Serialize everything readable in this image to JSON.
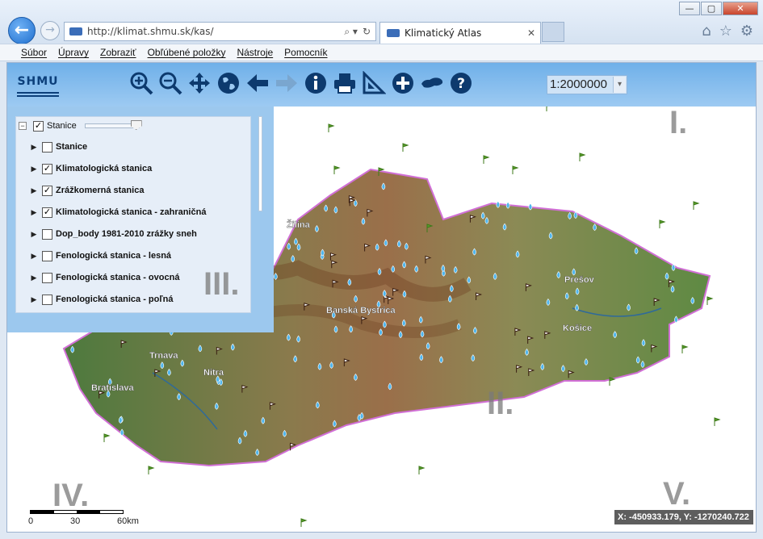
{
  "browser": {
    "url": "http://klimat.shmu.sk/kas/",
    "tab_title": "Klimatický Atlas",
    "menu": [
      "Súbor",
      "Úpravy",
      "Zobraziť",
      "Obľúbené položky",
      "Nástroje",
      "Pomocník"
    ],
    "window_controls": {
      "minimize": "—",
      "maximize": "▢",
      "close": "✕"
    },
    "right_icons": [
      "home-icon",
      "star-icon",
      "gear-icon"
    ]
  },
  "app": {
    "logo_text": "SHMU",
    "scale": "1:2000000",
    "toolbar_tools": [
      "zoom-in",
      "zoom-out",
      "pan",
      "globe",
      "back",
      "forward",
      "info",
      "print",
      "measure",
      "add",
      "region-select",
      "help"
    ]
  },
  "layers": {
    "root": {
      "label": "Stanice",
      "checked": true
    },
    "items": [
      {
        "label": "Stanice",
        "checked": false
      },
      {
        "label": "Klimatologická stanica",
        "checked": true
      },
      {
        "label": "Zrážkomerná stanica",
        "checked": true
      },
      {
        "label": "Klimatologická stanica - zahraničná",
        "checked": true
      },
      {
        "label": "Dop_body 1981-2010 zrážky sneh",
        "checked": false
      },
      {
        "label": "Fenologická stanica - lesná",
        "checked": false
      },
      {
        "label": "Fenologická stanica - ovocná",
        "checked": false
      },
      {
        "label": "Fenologická stanica - poľná",
        "checked": false
      }
    ]
  },
  "map": {
    "cities": [
      "Žilina",
      "Prešov",
      "Banská Bystrica",
      "Košice",
      "Trnava",
      "Nitra",
      "Bratislava"
    ],
    "region_labels": {
      "r1": "I.",
      "r2": "II.",
      "r3": "III.",
      "r4": "IV.",
      "r5": "V."
    },
    "scalebar": {
      "l0": "0",
      "l1": "30",
      "l2": "60km"
    },
    "coordinates": "X: -450933.179, Y: -1270240.722"
  },
  "colors": {
    "toolbar": "#7db8ec",
    "panel_bg": "#9cc8ee",
    "terrain": "#b9a56b",
    "border": "#d16fd6"
  }
}
